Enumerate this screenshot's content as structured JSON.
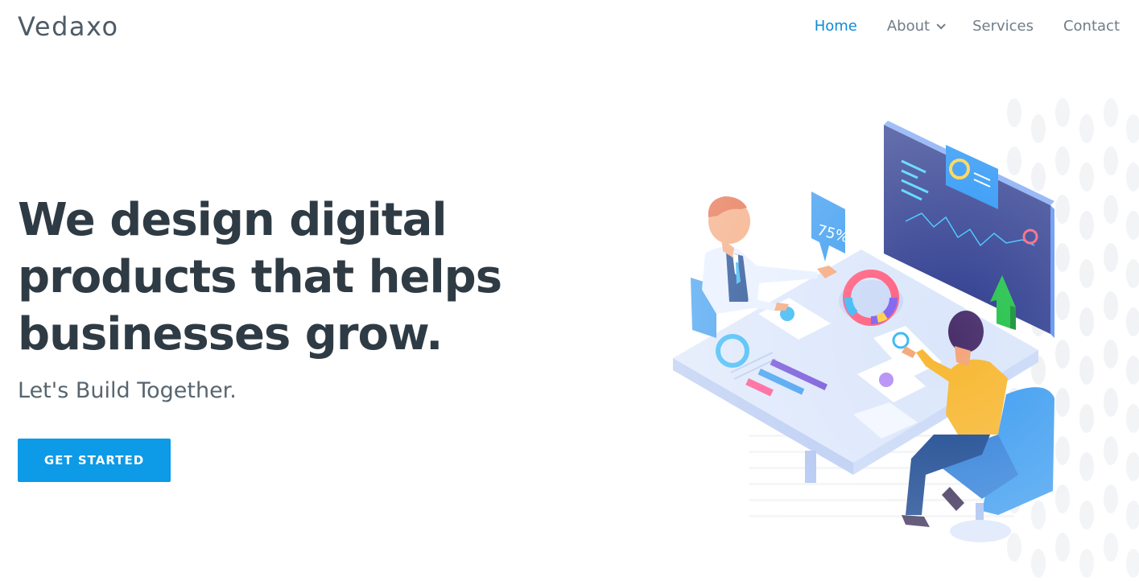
{
  "header": {
    "brand": "Vedaxo",
    "nav": [
      {
        "label": "Home",
        "active": true
      },
      {
        "label": "About",
        "has_dropdown": true
      },
      {
        "label": "Services"
      },
      {
        "label": "Contact"
      }
    ]
  },
  "hero": {
    "title_lines": [
      "We design digital",
      "products that helps",
      "businesses grow."
    ],
    "subtitle": "Let's Build Together.",
    "cta_label": "GET STARTED",
    "illustration": {
      "bubble_text": "75%",
      "icons": [
        "chevron-down-icon",
        "up-arrow-icon",
        "donut-chart-icon"
      ]
    }
  },
  "colors": {
    "accent": "#0d9ae6",
    "nav_active": "#0f8ad8",
    "text_dark": "#2f3b44",
    "text_muted": "#6f7d88",
    "monitor": "#2d3b8e",
    "table": "#dbe6fb"
  }
}
